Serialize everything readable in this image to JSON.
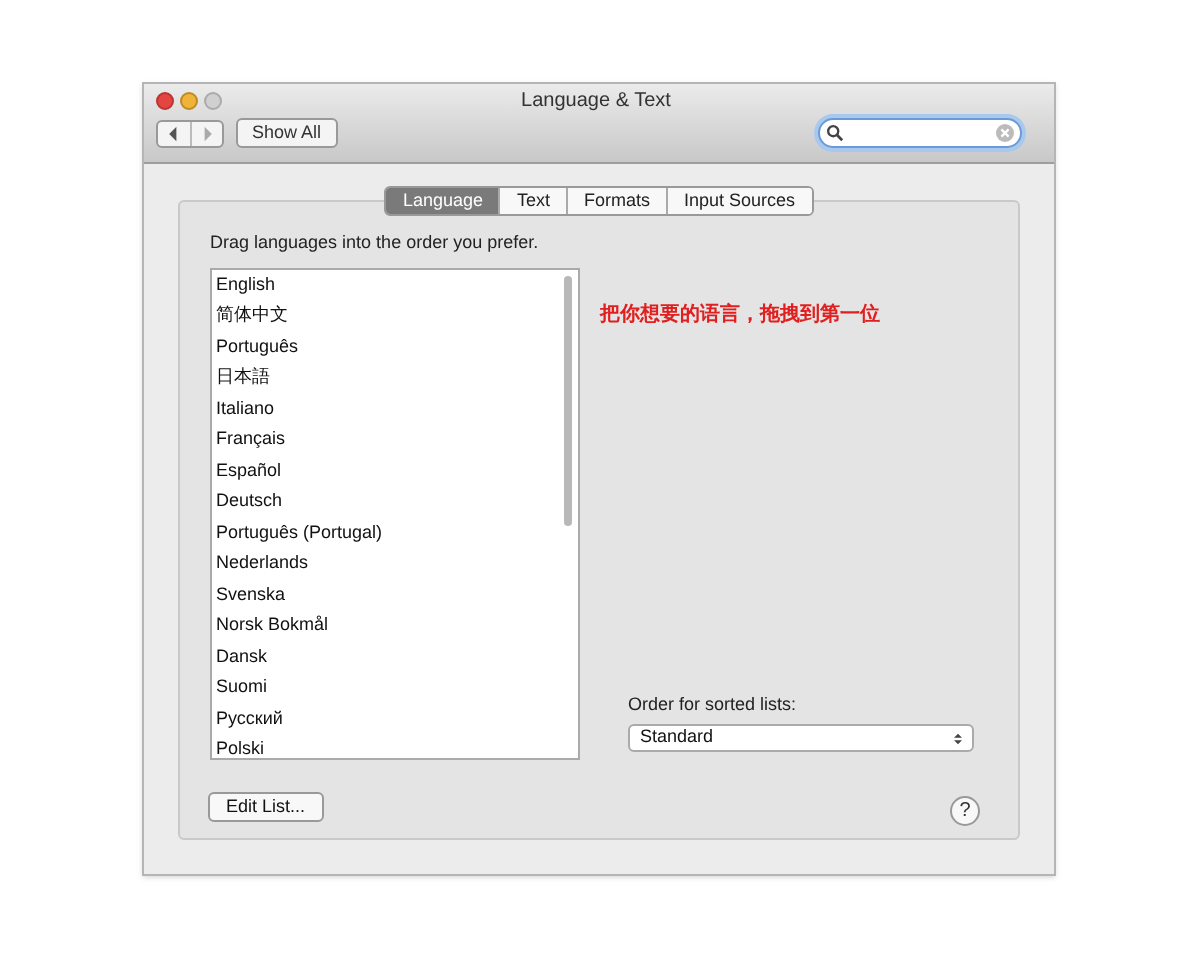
{
  "window": {
    "title": "Language & Text"
  },
  "toolbar": {
    "show_all": "Show All"
  },
  "tabs": [
    {
      "label": "Language",
      "selected": true
    },
    {
      "label": "Text",
      "selected": false
    },
    {
      "label": "Formats",
      "selected": false
    },
    {
      "label": "Input Sources",
      "selected": false
    }
  ],
  "instruction": "Drag languages into the order you prefer.",
  "languages": [
    "English",
    "简体中文",
    "Português",
    "日本語",
    "Italiano",
    "Français",
    "Español",
    "Deutsch",
    "Português (Portugal)",
    "Nederlands",
    "Svenska",
    "Norsk Bokmål",
    "Dansk",
    "Suomi",
    "Русский",
    "Polski"
  ],
  "annotation": "把你想要的语言，拖拽到第一位",
  "sort_order": {
    "label": "Order for sorted lists:",
    "value": "Standard"
  },
  "edit_list_button": "Edit List...",
  "help_button": "?"
}
